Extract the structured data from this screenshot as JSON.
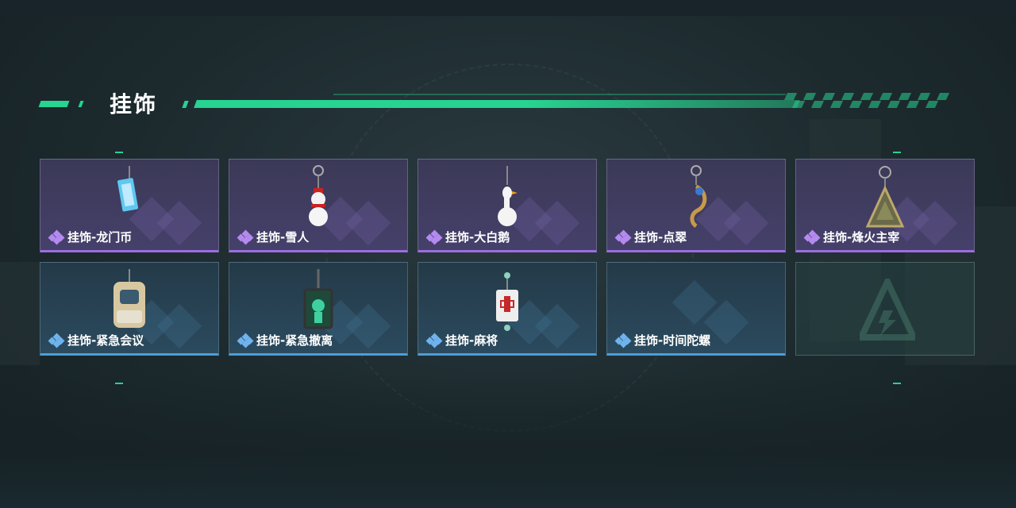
{
  "page": {
    "title": "挂饰"
  },
  "colors": {
    "accent": "#27d390",
    "purple_rarity": "#9b6ee0",
    "blue_rarity": "#4d9ed8"
  },
  "items": [
    {
      "label": "挂饰-龙门币",
      "rarity": "purple",
      "icon": "coin-card-charm-icon"
    },
    {
      "label": "挂饰-雪人",
      "rarity": "purple",
      "icon": "snowman-charm-icon"
    },
    {
      "label": "挂饰-大白鹅",
      "rarity": "purple",
      "icon": "white-goose-charm-icon"
    },
    {
      "label": "挂饰-点翠",
      "rarity": "purple",
      "icon": "phoenix-charm-icon"
    },
    {
      "label": "挂饰-烽火主宰",
      "rarity": "purple",
      "icon": "triangle-emblem-charm-icon"
    },
    {
      "label": "挂饰-紧急会议",
      "rarity": "blue",
      "icon": "meeting-figure-charm-icon"
    },
    {
      "label": "挂饰-紧急撤离",
      "rarity": "blue",
      "icon": "evacuation-tag-charm-icon"
    },
    {
      "label": "挂饰-麻将",
      "rarity": "blue",
      "icon": "mahjong-tile-charm-icon"
    },
    {
      "label": "挂饰-时间陀螺",
      "rarity": "blue",
      "icon": "none"
    },
    {
      "label": "",
      "rarity": "empty",
      "icon": "empty-slot-logo-icon"
    }
  ]
}
